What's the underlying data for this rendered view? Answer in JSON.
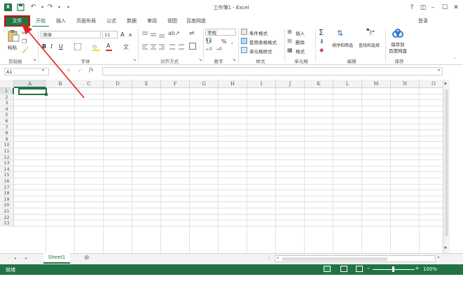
{
  "title": "工作簿1 - Excel",
  "qat": {
    "save_icon": "save-icon",
    "undo_icon": "undo-icon",
    "redo_icon": "redo-icon"
  },
  "window": {
    "help": "?",
    "ribbon_options": "◫",
    "minimize": "–",
    "restore": "☐",
    "close": "✕"
  },
  "tabs": [
    "文件",
    "开始",
    "插入",
    "页面布局",
    "公式",
    "数据",
    "审阅",
    "视图",
    "百度网盘"
  ],
  "login": "登录",
  "ribbon": {
    "paste": "粘贴",
    "clipboard": "剪贴板",
    "font_name": "宋体",
    "font_size": "11",
    "grow_font": "A",
    "shrink_font": "A",
    "bold": "B",
    "italic": "I",
    "underline": "U",
    "font_color_letter": "A",
    "font_group": "字体",
    "alignment_group": "对齐方式",
    "number_format": "常规",
    "percent": "%",
    "comma": ",",
    "number_group": "数字",
    "conditional_format": "条件格式",
    "table_format": "套用表格格式",
    "cell_styles": "单元格样式",
    "styles_group": "样式",
    "insert": "插入",
    "delete": "删除",
    "format": "格式",
    "cells_group": "单元格",
    "sum": "Σ",
    "sort_filter": "排序和筛选",
    "find_select": "查找和选择",
    "editing_group": "编辑",
    "save_to_baidu": "保存到",
    "save_to_baidu_2": "百度网盘",
    "save_group": "保存"
  },
  "formula_bar": {
    "name_box": "A1",
    "cancel": "✕",
    "enter": "✓",
    "fx": "fx",
    "value": ""
  },
  "columns": [
    "A",
    "B",
    "C",
    "D",
    "E",
    "F",
    "G",
    "H",
    "I",
    "J",
    "K",
    "L",
    "M",
    "N",
    "O"
  ],
  "rows": [
    "1",
    "2",
    "3",
    "4",
    "5",
    "6",
    "7",
    "8",
    "9",
    "10",
    "11",
    "12",
    "13",
    "14",
    "15",
    "16",
    "17",
    "18",
    "19",
    "20",
    "21",
    "22",
    "23"
  ],
  "sheets": [
    "Sheet1"
  ],
  "add_sheet": "⊕",
  "status": {
    "ready": "就绪",
    "zoom": "100%",
    "zoom_minus": "–",
    "zoom_plus": "+"
  },
  "colors": {
    "excel_green": "#217346",
    "arrow_red": "#e02020"
  }
}
